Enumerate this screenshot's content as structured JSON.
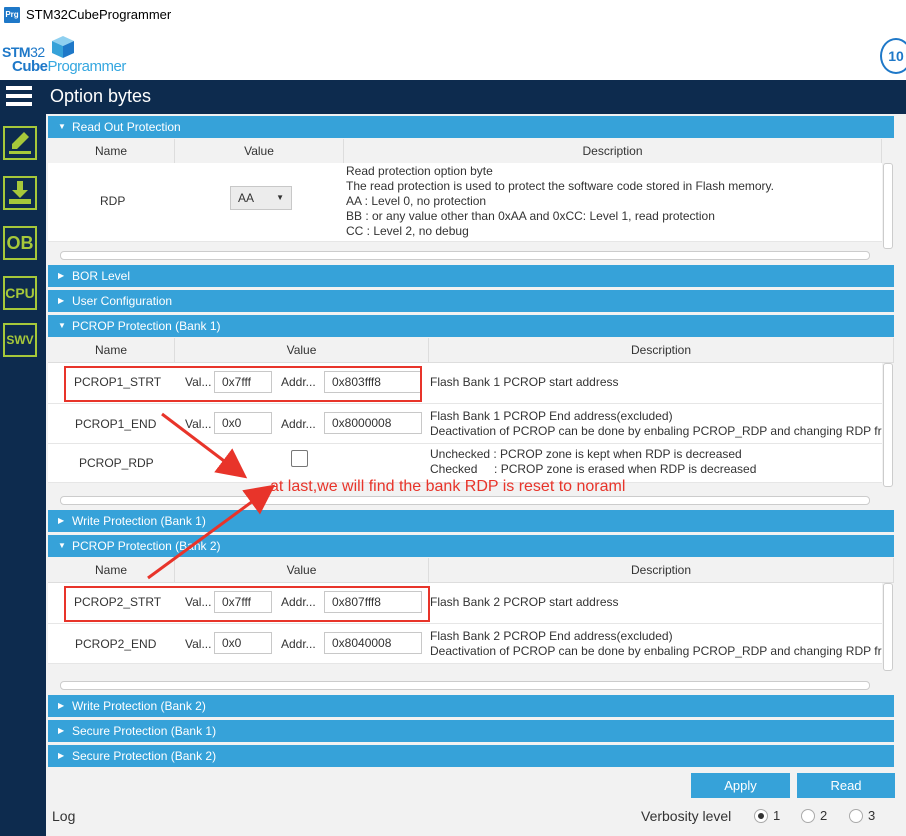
{
  "window": {
    "title": "STM32CubeProgrammer",
    "icon_label": "Prg"
  },
  "logo": {
    "stm": "STM",
    "stm_num": "32",
    "cube": "Cube",
    "programmer": "Programmer",
    "badge": "10"
  },
  "sidebar": {
    "items": [
      {
        "label": "",
        "icon": "pencil-icon"
      },
      {
        "label": "",
        "icon": "download-icon"
      },
      {
        "label": "OB",
        "icon": "ob-icon"
      },
      {
        "label": "CPU",
        "icon": "cpu-icon"
      },
      {
        "label": "SWV",
        "icon": "swv-icon"
      }
    ]
  },
  "header": {
    "title": "Option bytes"
  },
  "sections": {
    "read_out": {
      "label": "Read Out Protection",
      "expanded": true
    },
    "bor": {
      "label": "BOR Level"
    },
    "user_config": {
      "label": "User Configuration"
    },
    "pcrop1": {
      "label": "PCROP Protection (Bank 1)",
      "expanded": true
    },
    "write1": {
      "label": "Write Protection (Bank 1)"
    },
    "pcrop2": {
      "label": "PCROP Protection (Bank 2)",
      "expanded": true
    },
    "write2": {
      "label": "Write Protection (Bank 2)"
    },
    "secure1": {
      "label": "Secure Protection (Bank 1)"
    },
    "secure2": {
      "label": "Secure Protection (Bank 2)"
    }
  },
  "columns": {
    "name": "Name",
    "value": "Value",
    "description": "Description"
  },
  "rdp": {
    "name": "RDP",
    "value": "AA",
    "description": [
      "Read protection option byte",
      "The read protection is used to protect the software code stored in Flash memory.",
      "AA : Level 0, no protection",
      "BB : or any value other than 0xAA and 0xCC: Level 1, read protection",
      "CC : Level 2, no debug"
    ]
  },
  "pcrop1_rows": [
    {
      "name": "PCROP1_STRT",
      "val_label": "Val...",
      "val": "0x7fff",
      "addr_label": "Addr...",
      "addr": "0x803fff8",
      "desc": [
        "Flash Bank 1 PCROP start address"
      ]
    },
    {
      "name": "PCROP1_END",
      "val_label": "Val...",
      "val": "0x0",
      "addr_label": "Addr...",
      "addr": "0x8000008",
      "desc": [
        "Flash Bank 1 PCROP End address(excluded)",
        "Deactivation of PCROP can be done by enbaling PCROP_RDP and changing RDP from"
      ]
    },
    {
      "name": "PCROP_RDP",
      "checked": false,
      "desc": [
        "Unchecked : PCROP zone is kept when RDP is decreased",
        "Checked     : PCROP zone is erased when RDP is decreased"
      ]
    }
  ],
  "pcrop2_rows": [
    {
      "name": "PCROP2_STRT",
      "val_label": "Val...",
      "val": "0x7fff",
      "addr_label": "Addr...",
      "addr": "0x807fff8",
      "desc": [
        "Flash Bank 2 PCROP start address"
      ]
    },
    {
      "name": "PCROP2_END",
      "val_label": "Val...",
      "val": "0x0",
      "addr_label": "Addr...",
      "addr": "0x8040008",
      "desc": [
        "Flash Bank 2 PCROP End address(excluded)",
        "Deactivation of PCROP can be done by enbaling PCROP_RDP and changing RDP from"
      ]
    }
  ],
  "annotation": {
    "text": "at last,we will find the bank RDP is reset to noraml",
    "color": "#e8342a"
  },
  "actions": {
    "apply": "Apply",
    "read": "Read"
  },
  "log": {
    "label": "Log",
    "verbosity_label": "Verbosity level",
    "levels": [
      "1",
      "2",
      "3"
    ],
    "selected": "1"
  },
  "colors": {
    "sidebar": "#0d2b4e",
    "section": "#36a2d9",
    "accent": "#a6c83a",
    "annotation": "#e8342a"
  }
}
